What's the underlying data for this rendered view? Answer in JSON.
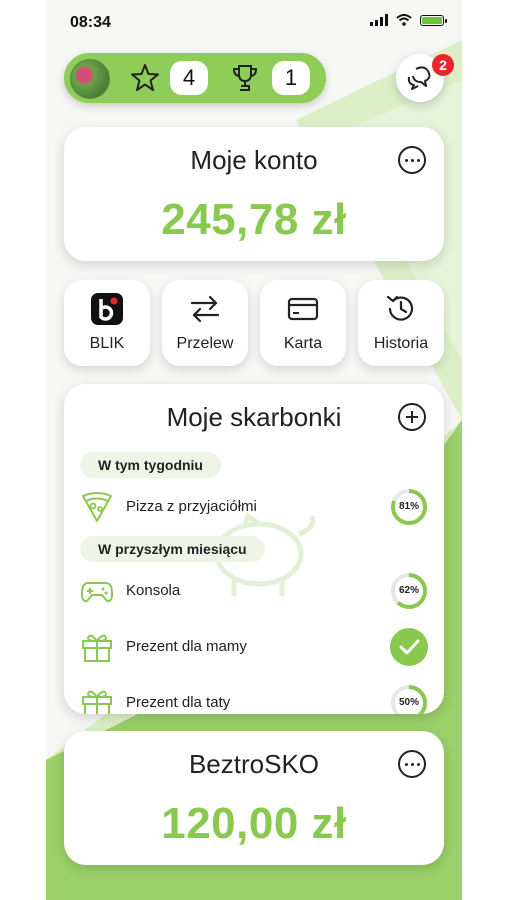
{
  "status_bar": {
    "time": "08:34"
  },
  "header": {
    "stars_count": "4",
    "trophies_count": "1",
    "notifications_count": "2"
  },
  "account": {
    "title": "Moje konto",
    "balance": "245,78 zł"
  },
  "actions": [
    {
      "label": "BLIK",
      "icon": "blik-icon"
    },
    {
      "label": "Przelew",
      "icon": "transfer-icon"
    },
    {
      "label": "Karta",
      "icon": "card-icon"
    },
    {
      "label": "Historia",
      "icon": "history-icon"
    }
  ],
  "piggybanks": {
    "title": "Moje skarbonki",
    "sections": [
      {
        "label": "W tym tygodniu",
        "items": [
          {
            "name": "Pizza z przyjaciółmi",
            "icon": "pizza-icon",
            "progress_label": "81%",
            "progress": 0.81
          }
        ]
      },
      {
        "label": "W przyszłym miesiącu",
        "items": [
          {
            "name": "Konsola",
            "icon": "gamepad-icon",
            "progress_label": "62%",
            "progress": 0.62
          },
          {
            "name": "Prezent dla mamy",
            "icon": "gift-icon",
            "progress_label": "",
            "progress": 1.0
          },
          {
            "name": "Prezent dla taty",
            "icon": "gift-icon",
            "progress_label": "50%",
            "progress": 0.5
          }
        ]
      }
    ]
  },
  "second_account": {
    "title": "BeztroSKO",
    "balance": "120,00 zł"
  },
  "colors": {
    "accent": "#89c94f",
    "pill": "#8dcd58",
    "notification": "#e8262b"
  }
}
